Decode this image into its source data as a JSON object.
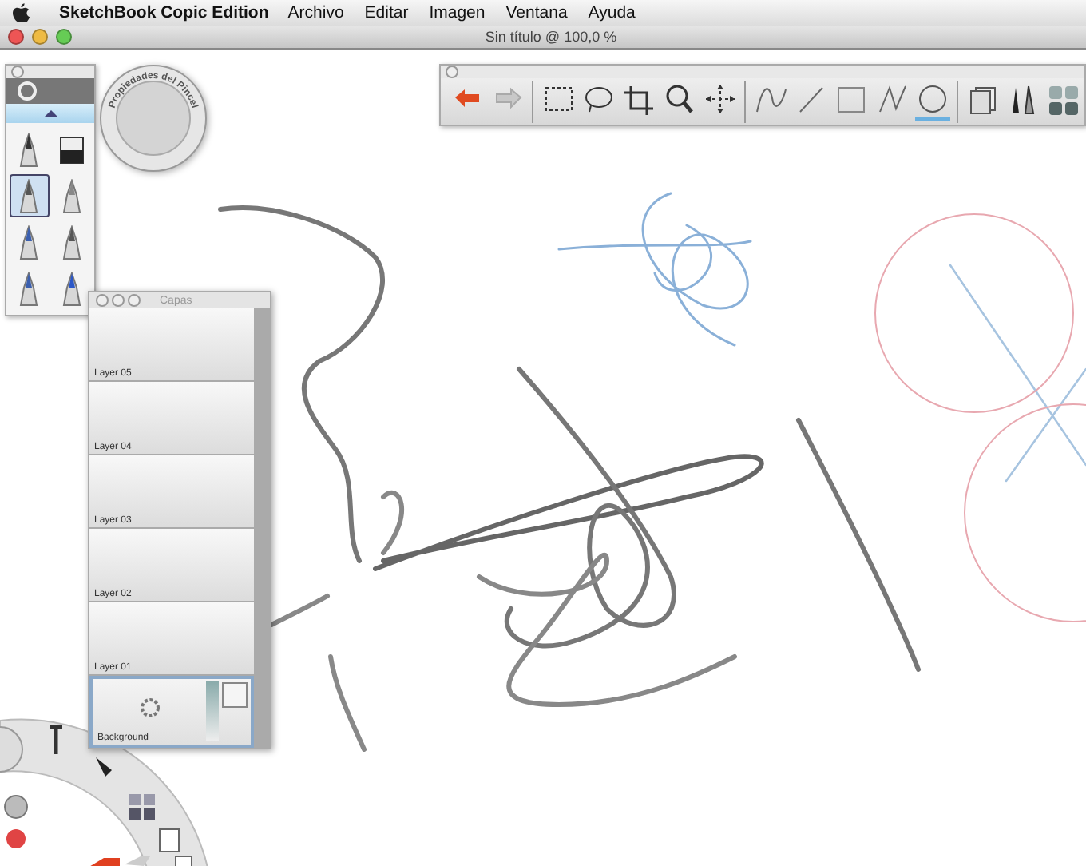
{
  "menubar": {
    "app_name": "SketchBook Copic Edition",
    "menus": [
      "Archivo",
      "Editar",
      "Imagen",
      "Ventana",
      "Ayuda"
    ]
  },
  "window": {
    "title": "Sin título @ 100,0 %"
  },
  "brush_palette": {
    "brushes": [
      {
        "selected": false
      },
      {
        "selected": false
      },
      {
        "selected": true
      },
      {
        "selected": false
      },
      {
        "selected": false
      },
      {
        "selected": false
      },
      {
        "selected": false
      },
      {
        "selected": false
      }
    ]
  },
  "brush_puck": {
    "label": "Propiedades del Pincel"
  },
  "toolbar": {
    "tools": [
      {
        "selected": false
      },
      {
        "selected": false
      },
      {
        "selected": false
      },
      {
        "selected": false
      },
      {
        "selected": false
      },
      {
        "selected": false
      },
      {
        "selected": false
      },
      {
        "selected": false
      },
      {
        "selected": false
      },
      {
        "selected": false
      },
      {
        "selected": false
      },
      {
        "selected": true
      },
      {
        "selected": false
      },
      {
        "selected": false
      },
      {
        "selected": false
      }
    ]
  },
  "layers": {
    "title": "Capas",
    "items": [
      {
        "name": "Layer 05",
        "selected": false
      },
      {
        "name": "Layer 04",
        "selected": false
      },
      {
        "name": "Layer 03",
        "selected": false
      },
      {
        "name": "Layer 02",
        "selected": false
      },
      {
        "name": "Layer 01",
        "selected": false
      },
      {
        "name": "Background",
        "selected": true
      }
    ]
  }
}
